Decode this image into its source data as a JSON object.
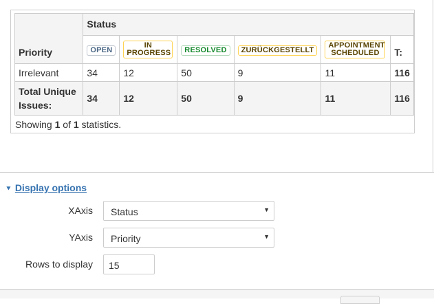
{
  "table": {
    "status_header": "Status",
    "priority_header": "Priority",
    "columns": [
      {
        "label": "OPEN",
        "style": "loz-open"
      },
      {
        "label": "IN PROGRESS",
        "style": "loz-inprog"
      },
      {
        "label": "RESOLVED",
        "style": "loz-resolved"
      },
      {
        "label": "ZURÜCKGESTELLT",
        "style": "loz-zur"
      },
      {
        "label": "APPOINTMENT SCHEDULED",
        "style": "loz-appt"
      }
    ],
    "total_col_header": "T:",
    "rows": [
      {
        "label": "Irrelevant",
        "values": [
          "34",
          "12",
          "50",
          "9",
          "11"
        ],
        "total": "116"
      }
    ],
    "totals": {
      "label": "Total Unique Issues:",
      "values": [
        "34",
        "12",
        "50",
        "9",
        "11"
      ],
      "total": "116"
    }
  },
  "showing": {
    "prefix": "Showing ",
    "current": "1",
    "of": " of ",
    "total": "1",
    "suffix": " statistics."
  },
  "display_options": {
    "toggle_label": "Display options",
    "xaxis_label": "XAxis",
    "xaxis_value": "Status",
    "yaxis_label": "YAxis",
    "yaxis_value": "Priority",
    "rows_label": "Rows to display",
    "rows_value": "15"
  },
  "colors": {
    "link": "#3572b0",
    "border": "#cccccc",
    "header_bg": "#f4f4f4"
  }
}
